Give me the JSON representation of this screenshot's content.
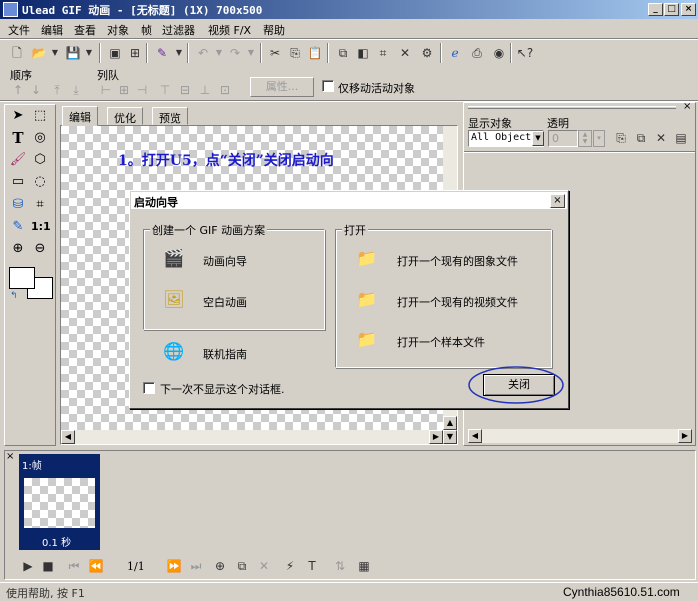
{
  "title": "Ulead GIF 动画 - [无标题] (1X) 700x500",
  "menu": [
    "文件",
    "编辑",
    "查看",
    "对象",
    "帧",
    "过滤器",
    "视频 F/X",
    "帮助"
  ],
  "toolbar2": {
    "order_label": "顺序",
    "align_label": "列队",
    "properties_label": "属性...",
    "move_only_label": "仅移动活动对象"
  },
  "tabs": [
    "编辑",
    "优化",
    "预览"
  ],
  "canvas_text": "1。打开U5，点“关闭”关闭启动向",
  "tools": {
    "ratio_label": "1:1"
  },
  "object_panel": {
    "display_label": "显示对象",
    "transparency_label": "透明",
    "select_value": "All Objects",
    "transparency_value": "0"
  },
  "dialog": {
    "title": "启动向导",
    "create_group": "创建一个 GIF 动画方案",
    "animation_wizard": "动画向导",
    "blank_animation": "空白动画",
    "online_guide": "联机指南",
    "open_group": "打开",
    "open_image": "打开一个现有的图象文件",
    "open_video": "打开一个现有的视频文件",
    "open_sample": "打开一个样本文件",
    "dont_show": "下一次不显示这个对话框.",
    "close_button": "关闭"
  },
  "frames": {
    "frame_label": "1:帧",
    "frame_delay": "0.1 秒",
    "counter": "1/1"
  },
  "status": {
    "help_text": "使用帮助, 按 F1",
    "watermark": "Cynthia85610.51.com"
  },
  "colors": {
    "titlebar_start": "#0a246a",
    "titlebar_end": "#a6caf0",
    "canvas_text": "#1a1acc",
    "annotation_ellipse": "#2233bb",
    "frame_selected": "#0a246a"
  }
}
